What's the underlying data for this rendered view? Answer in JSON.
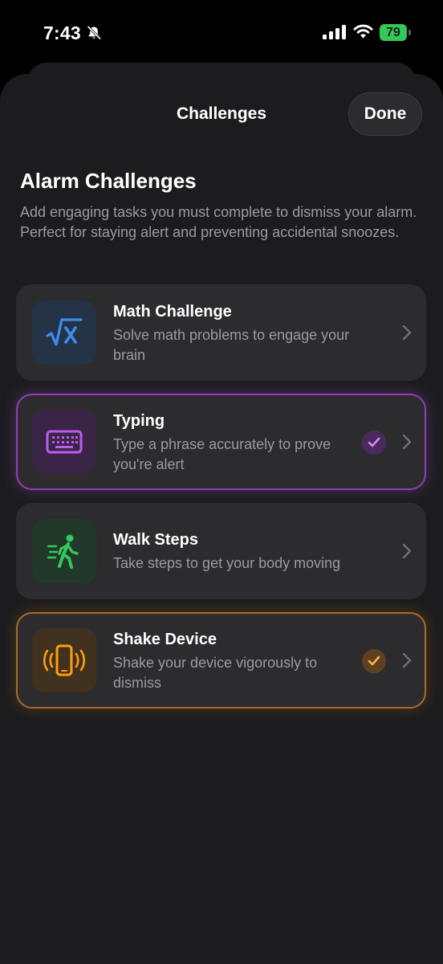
{
  "status_bar": {
    "time": "7:43",
    "battery_level": "79",
    "icons": [
      "bell-slash-icon",
      "cellular-signal-icon",
      "wifi-icon",
      "battery-charging-icon"
    ]
  },
  "nav": {
    "title": "Challenges",
    "done_label": "Done"
  },
  "header": {
    "title": "Alarm Challenges",
    "description": "Add engaging tasks you must complete to dismiss your alarm. Perfect for staying alert and preventing accidental snoozes."
  },
  "challenges": [
    {
      "title": "Math Challenge",
      "description": "Solve math problems to engage your brain",
      "icon": "square-root-icon",
      "accent": "#3d8df5",
      "selected": false
    },
    {
      "title": "Typing",
      "description": "Type a phrase accurately to prove you're alert",
      "icon": "keyboard-icon",
      "accent": "#bf5af2",
      "selected": true
    },
    {
      "title": "Walk Steps",
      "description": "Take steps to get your body moving",
      "icon": "figure-walk-motion-icon",
      "accent": "#34c759",
      "selected": false
    },
    {
      "title": "Shake Device",
      "description": "Shake your device vigorously to dismiss",
      "icon": "phone-shake-icon",
      "accent": "#ff9f0a",
      "selected": true
    }
  ],
  "colors": {
    "sheet_background": "#1c1c1e",
    "card_background": "#2c2c2e",
    "secondary_text": "#9a9aa0"
  }
}
